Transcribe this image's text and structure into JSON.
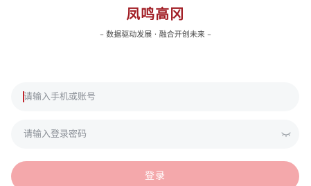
{
  "brand": {
    "title": "凤鸣高冈",
    "slogan": "– 数据驱动发展 · 融合开创未来 –",
    "accent_color": "#a11d24"
  },
  "form": {
    "account_placeholder": "请输入手机或账号",
    "password_placeholder": "请输入登录密码",
    "password_toggle_icon": "eye-closed-icon",
    "submit_label": "登录",
    "submit_color": "#f4a8ab"
  }
}
